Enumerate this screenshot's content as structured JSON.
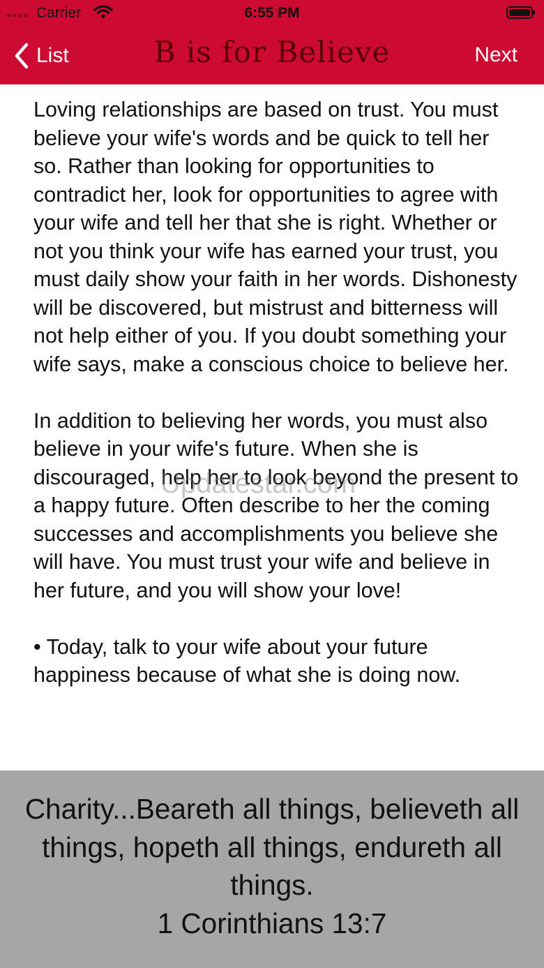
{
  "status_bar": {
    "carrier": "Carrier",
    "time": "6:55 PM"
  },
  "nav": {
    "back_label": "List",
    "title": "B is for Believe",
    "next_label": "Next"
  },
  "content": {
    "paragraphs": [
      "Loving relationships are based on trust. You must believe your wife's words and be quick to tell her so. Rather than looking for opportunities to contradict her, look for opportunities to agree with your wife and tell her that she is right. Whether or not you think your wife has earned your trust, you must daily show your faith in her words. Dishonesty will be discovered, but mistrust and bitterness will not help either of you. If you doubt something your wife says, make a conscious choice to believe her.",
      "In addition to believing her words, you must also believe in your wife's future. When she is discouraged, help her to look beyond the present to a happy future. Often describe to her the coming successes and accomplishments you believe she will have. You must trust your wife and believe in her future, and you will show your love!",
      "• Today, talk to your wife about your future happiness because of what she is doing now."
    ],
    "watermark": "Updatestar.com"
  },
  "verse": {
    "text": "Charity...Beareth all things, believeth all things, hopeth all things, endureth all things.",
    "reference": "1 Corinthians 13:7"
  },
  "colors": {
    "nav_background": "#cc0a32",
    "title_color": "#5a0000",
    "verse_background": "#a6a6a6"
  }
}
